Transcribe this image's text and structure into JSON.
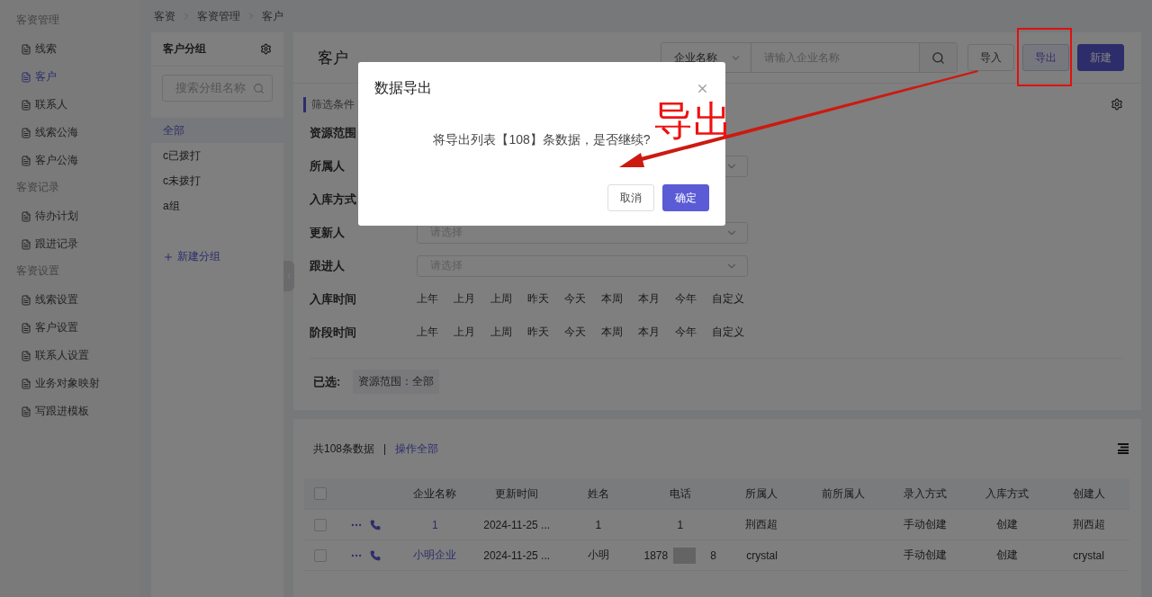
{
  "breadcrumb": [
    "客资",
    "客资管理",
    "客户"
  ],
  "sidebar": {
    "sections": [
      {
        "title": "客资管理",
        "items": [
          {
            "label": "线索",
            "selected": false
          },
          {
            "label": "客户",
            "selected": true
          },
          {
            "label": "联系人",
            "selected": false
          },
          {
            "label": "线索公海",
            "selected": false
          },
          {
            "label": "客户公海",
            "selected": false
          }
        ]
      },
      {
        "title": "客资记录",
        "items": [
          {
            "label": "待办计划",
            "selected": false
          },
          {
            "label": "跟进记录",
            "selected": false
          }
        ]
      },
      {
        "title": "客资设置",
        "items": [
          {
            "label": "线索设置",
            "selected": false
          },
          {
            "label": "客户设置",
            "selected": false
          },
          {
            "label": "联系人设置",
            "selected": false
          },
          {
            "label": "业务对象映射",
            "selected": false
          },
          {
            "label": "写跟进模板",
            "selected": false
          }
        ]
      }
    ]
  },
  "groups": {
    "title": "客户分组",
    "search": {
      "placeholder": "搜索分组名称"
    },
    "items": [
      {
        "label": "全部",
        "selected": true
      },
      {
        "label": "c已拨打",
        "selected": false
      },
      {
        "label": "c未拨打",
        "selected": false
      },
      {
        "label": "a组",
        "selected": false
      }
    ],
    "add_link": "新建分组"
  },
  "header": {
    "title": "客户",
    "search_field": {
      "value": "企业名称"
    },
    "search": {
      "placeholder": "请输入企业名称"
    },
    "buttons": [
      {
        "label": "导入",
        "kind": "default"
      },
      {
        "label": "导出",
        "kind": "default",
        "selected": true
      },
      {
        "label": "新建",
        "kind": "primary"
      }
    ]
  },
  "filters": {
    "title": "筛选条件",
    "rows": [
      {
        "label": "资源范围",
        "kind": "label"
      },
      {
        "label": "所属人",
        "kind": "select"
      },
      {
        "label": "入库方式",
        "kind": "label"
      },
      {
        "label": "更新人",
        "kind": "select",
        "placeholder": "请选择"
      },
      {
        "label": "跟进人",
        "kind": "select",
        "placeholder": "请选择"
      },
      {
        "label": "入库时间",
        "kind": "options",
        "options": [
          "上年",
          "上月",
          "上周",
          "昨天",
          "今天",
          "本周",
          "本月",
          "今年",
          "自定义"
        ]
      },
      {
        "label": "阶段时间",
        "kind": "options",
        "options": [
          "上年",
          "上月",
          "上周",
          "昨天",
          "今天",
          "本周",
          "本月",
          "今年",
          "自定义"
        ]
      }
    ],
    "selected_label": "已选:",
    "selected_tags": [
      "资源范围：全部"
    ]
  },
  "table": {
    "header_checked": false,
    "count": "共108条数据",
    "separator": "|",
    "bulk_link": "操作全部",
    "columns": [
      "企业名称",
      "更新时间",
      "姓名",
      "电话",
      "所属人",
      "前所属人",
      "录入方式",
      "入库方式",
      "创建人"
    ],
    "rows": [
      {
        "checked": false,
        "company": "1",
        "updated": "2024-11-25 ...",
        "name": "1",
        "phone": {
          "start": "1"
        },
        "owner": "荆西超",
        "entry": "手动创建",
        "storage": "创建",
        "creator": "荆西超"
      },
      {
        "checked": false,
        "company": "小明企业",
        "updated": "2024-11-25 ...",
        "name": "小明",
        "phone": {
          "start": "1878",
          "end": "8"
        },
        "owner": "crystal",
        "entry": "手动创建",
        "storage": "创建",
        "creator": "crystal"
      }
    ]
  },
  "dialog": {
    "title": "数据导出",
    "message": "将导出列表【108】条数据，是否继续?",
    "buttons": [
      {
        "label": "取消",
        "kind": "default"
      },
      {
        "label": "确定",
        "kind": "primary"
      }
    ]
  },
  "annotation": {
    "label": "导出"
  }
}
